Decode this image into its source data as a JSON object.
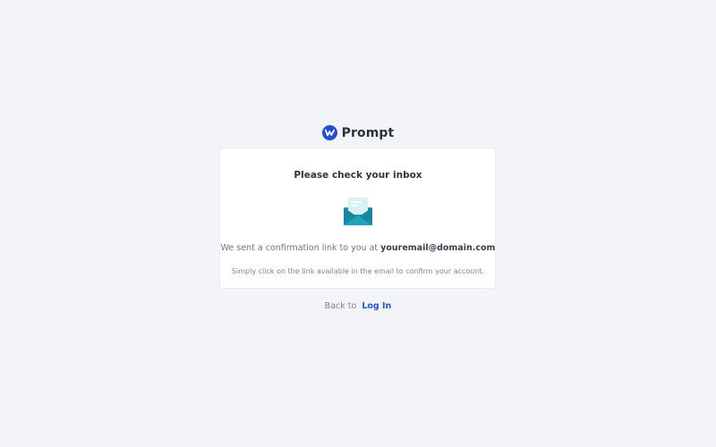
{
  "brand": {
    "name": "Prompt",
    "logo_icon": "prompt-logo-icon",
    "color": "#1f4fd6"
  },
  "card": {
    "title": "Please check your inbox",
    "icon": "open-envelope-icon",
    "message_prefix": "We sent a confirmation link to you at",
    "email": "youremail@domain.com",
    "hint": "Simply click on the link available in the email to confirm your account."
  },
  "footer": {
    "back_text": "Back to",
    "login_label": "Log In",
    "link_color": "#2257d6"
  },
  "colors": {
    "background": "#f3f4f8",
    "card": "#ffffff",
    "envelope_body": "#1b9db0",
    "envelope_flap": "#1587a0",
    "letter": "#d9f1f5"
  }
}
